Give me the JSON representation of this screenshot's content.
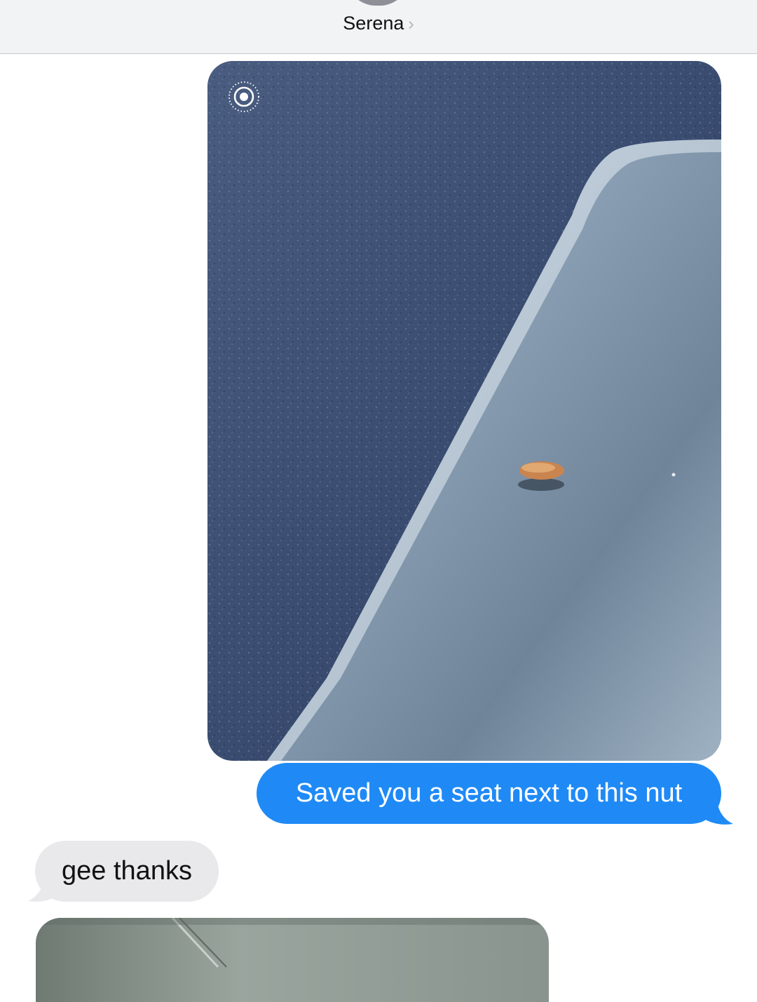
{
  "header": {
    "contact_name": "Serena",
    "chevron": "chevron-right-icon"
  },
  "messages": [
    {
      "type": "image",
      "direction": "outgoing",
      "image_description": "photo",
      "badge_icon": "live-photo-icon"
    },
    {
      "type": "text",
      "direction": "outgoing",
      "text": "Saved you a seat next to this nut"
    },
    {
      "type": "text",
      "direction": "incoming",
      "text": "gee thanks"
    },
    {
      "type": "image",
      "direction": "incoming",
      "image_description": "photo"
    }
  ],
  "colors": {
    "outgoing_bubble": "#1f8af6",
    "incoming_bubble": "#e9e9eb",
    "header_bg": "#f2f3f5"
  }
}
